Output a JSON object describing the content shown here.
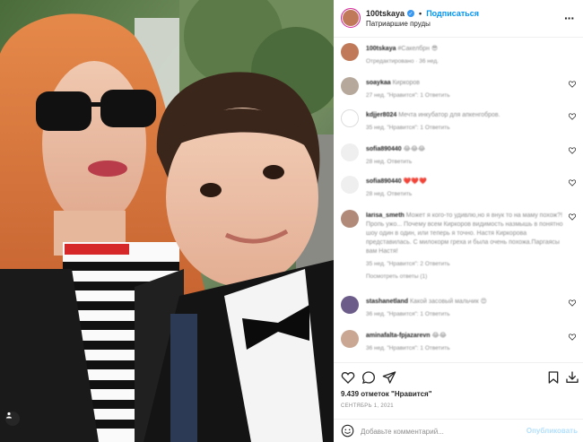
{
  "post": {
    "username": "100tskaya",
    "follow_label": "Подписаться",
    "location": "Патриаршие пруды",
    "separator": "•"
  },
  "caption": {
    "username": "100tskaya",
    "text": "#Сакелбрн 😎",
    "meta": "Отредактировано · 36 нед."
  },
  "comments": [
    {
      "user": "soaykaa",
      "text": "Киркоров",
      "meta": "27 нед.   \"Нравится\": 1   Ответить"
    },
    {
      "user": "kdjjer8024",
      "text": "Мечта инкубатор для апкенгобров.",
      "meta": "35 нед.   \"Нравится\": 1   Ответить"
    },
    {
      "user": "sofia890440",
      "text": "😂😂😂",
      "meta": "28 нед.   Ответить"
    },
    {
      "user": "sofia890440",
      "text": "❤️❤️❤️",
      "meta": "28 нед.   Ответить"
    },
    {
      "user": "larisa_smeth",
      "text": "Может я кого-то удивлю,но я внук то на маму похож?! Пропь ужо... Почему всем Киркоров видимость назмышь в понятно шоу один в один, или теперь я точно. Настя Киркорова представилась. С милокорм греха и была очень похожа.Паргаясы вам Настя!",
      "meta": "35 нед.   \"Нравится\": 2   Ответить",
      "more": "Посмотреть ответы (1)"
    },
    {
      "user": "stashanetland",
      "text": "Какой засовый мальчик 😍",
      "meta": "36 нед.   \"Нравится\": 1   Ответить"
    },
    {
      "user": "aminafalta-fpjazarevn",
      "text": "😂😂",
      "meta": "36 нед.   \"Нравится\": 1   Ответить"
    }
  ],
  "likes": "9.439 отметок \"Нравится\"",
  "date": "СЕНТЯБРЬ 1, 2021",
  "composer": {
    "placeholder": "Добавьте комментарий...",
    "publish_label": "Опубликовать"
  },
  "colors": {
    "accent": "#0095f6",
    "text": "#262626",
    "muted": "#8e8e8e",
    "like_heart": "#ed4956"
  },
  "icons": [
    "heart-icon",
    "comment-icon",
    "share-icon",
    "save-icon",
    "download-icon",
    "emoji-icon",
    "more-icon",
    "verified-icon",
    "tag-user-icon"
  ]
}
